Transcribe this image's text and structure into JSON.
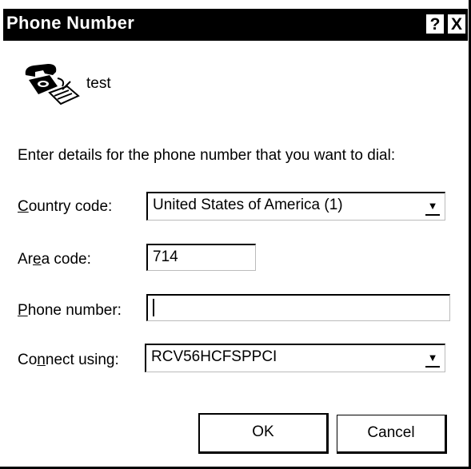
{
  "window": {
    "title": "Phone Number",
    "help_label": "?",
    "close_label": "X"
  },
  "entry": {
    "icon": "phone-icon",
    "name": "test"
  },
  "instructions": "Enter details for the phone number that you want to dial:",
  "fields": {
    "country_code": {
      "label_before": "",
      "label_accel": "C",
      "label_after": "ountry code:",
      "value": "United States of America (1)"
    },
    "area_code": {
      "label_before": "Ar",
      "label_accel": "e",
      "label_after": "a code:",
      "value": "714"
    },
    "phone_number": {
      "label_before": "",
      "label_accel": "P",
      "label_after": "hone number:",
      "value": ""
    },
    "connect_using": {
      "label_before": "Co",
      "label_accel": "n",
      "label_after": "nect using:",
      "value": "RCV56HCFSPPCI"
    }
  },
  "buttons": {
    "ok": "OK",
    "cancel": "Cancel"
  }
}
